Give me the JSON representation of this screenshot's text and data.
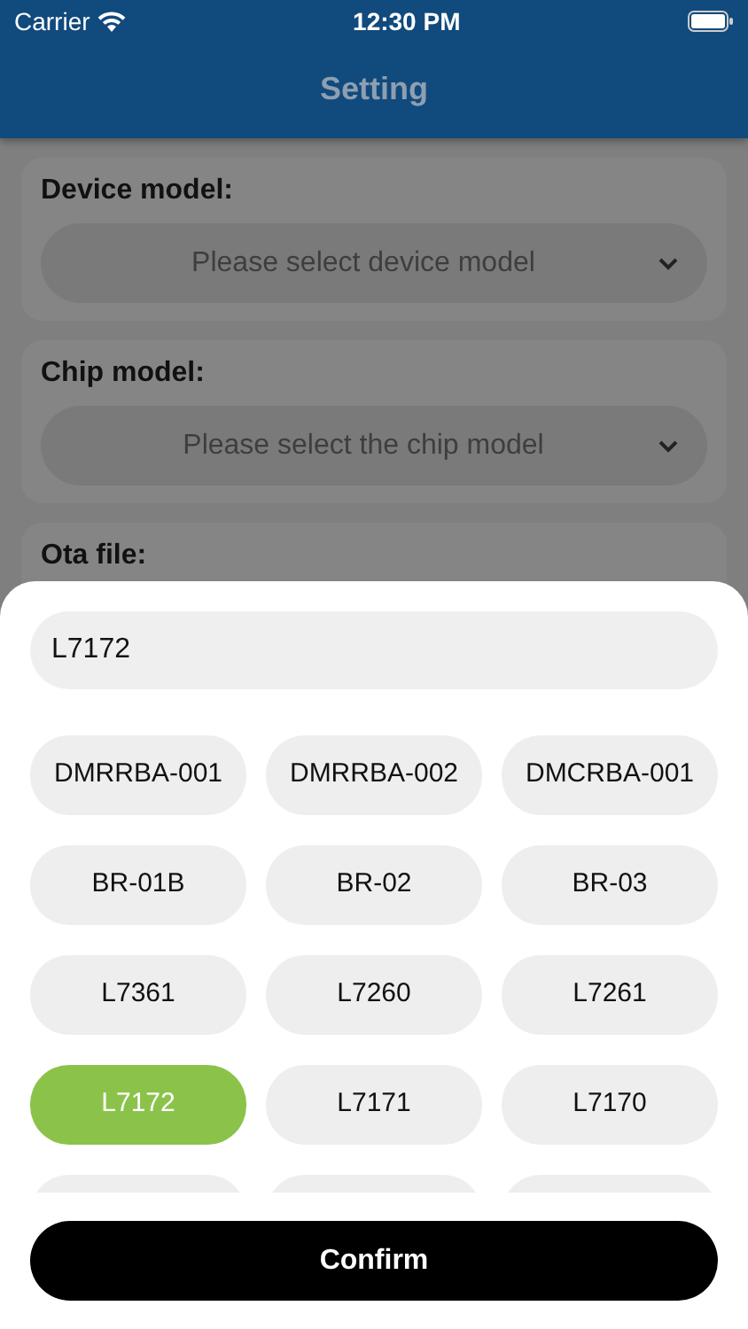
{
  "status_bar": {
    "carrier": "Carrier",
    "time": "12:30 PM"
  },
  "header": {
    "title": "Setting"
  },
  "form": [
    {
      "label": "Device model:",
      "placeholder": "Please select device model"
    },
    {
      "label": "Chip model:",
      "placeholder": "Please select the chip model"
    },
    {
      "label": "Ota file:"
    }
  ],
  "sheet": {
    "search": {
      "value": "L7172"
    },
    "chips": [
      {
        "kind": "chip",
        "label": "DMRRBA-001",
        "selected": false
      },
      {
        "kind": "chip",
        "label": "DMRRBA-002",
        "selected": false
      },
      {
        "kind": "chip",
        "label": "DMCRBA-001",
        "selected": false
      },
      {
        "kind": "chip",
        "label": "BR-01B",
        "selected": false
      },
      {
        "kind": "chip",
        "label": "BR-02",
        "selected": false
      },
      {
        "kind": "chip",
        "label": "BR-03",
        "selected": false
      },
      {
        "kind": "chip",
        "label": "L7361",
        "selected": false
      },
      {
        "kind": "chip",
        "label": "L7260",
        "selected": false
      },
      {
        "kind": "chip",
        "label": "L7261",
        "selected": false
      },
      {
        "kind": "chip",
        "label": "L7172",
        "selected": true
      },
      {
        "kind": "chip",
        "label": "L7171",
        "selected": false
      },
      {
        "kind": "chip",
        "label": "L7170",
        "selected": false
      },
      {
        "kind": "cut",
        "selected": false
      },
      {
        "kind": "cut",
        "selected": false
      },
      {
        "kind": "cut",
        "selected": false
      }
    ],
    "confirm": "Confirm"
  }
}
